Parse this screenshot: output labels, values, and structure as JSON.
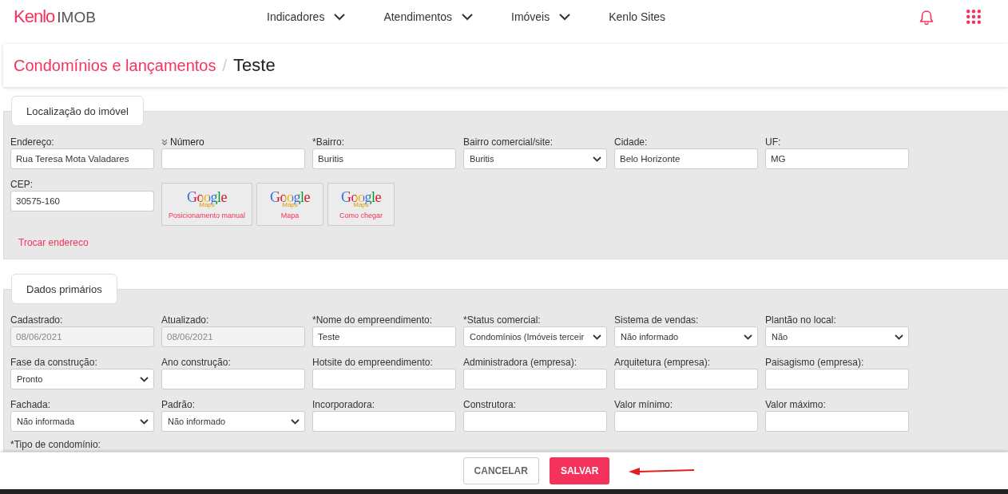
{
  "header": {
    "logo_brand": "Kenlo",
    "logo_product": "IMOB",
    "nav": [
      {
        "label": "Indicadores",
        "dropdown": true
      },
      {
        "label": "Atendimentos",
        "dropdown": true
      },
      {
        "label": "Imóveis",
        "dropdown": true
      },
      {
        "label": "Kenlo Sites",
        "dropdown": false
      }
    ]
  },
  "breadcrumb": {
    "parent": "Condomínios e lançamentos",
    "separator": "/",
    "current": "Teste"
  },
  "sections": [
    {
      "title": "Localização do imóvel",
      "rows": [
        [
          {
            "kind": "text",
            "label": "Endereço:",
            "value": "Rua Teresa Mota Valadares",
            "disabled": false
          },
          {
            "kind": "text",
            "label": "Número",
            "disabled": false,
            "toggle": true
          },
          {
            "kind": "text",
            "label": "*Bairro:",
            "value": "Buritis",
            "disabled": false
          },
          {
            "kind": "select",
            "label": "Bairro comercial/site:",
            "value": "Buritis",
            "disabled": false
          },
          {
            "kind": "text",
            "label": "Cidade:",
            "value": "Belo Horizonte",
            "disabled": false
          },
          {
            "kind": "text",
            "label": "UF:",
            "value": "MG",
            "disabled": false
          }
        ],
        [
          {
            "kind": "text",
            "label": "CEP:",
            "value": "30575-160",
            "disabled": false
          }
        ]
      ],
      "map_buttons": [
        {
          "logo": "Google",
          "logo_sub": "Maps",
          "label": "Posicionamento manual"
        },
        {
          "logo": "Google",
          "logo_sub": "Maps",
          "label": "Mapa"
        },
        {
          "logo": "Google",
          "logo_sub": "Maps",
          "label": "Como chegar"
        }
      ],
      "link": "Trocar endereco"
    },
    {
      "title": "Dados primários",
      "rows": [
        [
          {
            "kind": "text",
            "label": "Cadastrado:",
            "value": "08/06/2021",
            "disabled": true
          },
          {
            "kind": "text",
            "label": "Atualizado:",
            "value": "08/06/2021",
            "disabled": true
          },
          {
            "kind": "text",
            "label": "*Nome do empreendimento:",
            "value": "Teste",
            "disabled": false
          },
          {
            "kind": "select",
            "label": "*Status comercial:",
            "value": "Condomínios (Imóveis terceir",
            "disabled": false
          },
          {
            "kind": "select",
            "label": "Sistema de vendas:",
            "value": "Não informado",
            "disabled": false
          },
          {
            "kind": "select",
            "label": "Plantão no local:",
            "value": "Não",
            "disabled": false
          }
        ],
        [
          {
            "kind": "select",
            "label": "Fase da construção:",
            "value": "Pronto",
            "disabled": false
          },
          {
            "kind": "text",
            "label": "Ano construção:",
            "disabled": false
          },
          {
            "kind": "text",
            "label": "Hotsite do empreendimento:",
            "disabled": false
          },
          {
            "kind": "text",
            "label": "Administradora (empresa):",
            "disabled": false
          },
          {
            "kind": "text",
            "label": "Arquitetura (empresa):",
            "disabled": false
          },
          {
            "kind": "text",
            "label": "Paisagismo (empresa):",
            "disabled": false
          }
        ],
        [
          {
            "kind": "select",
            "label": "Fachada:",
            "value": "Não informada",
            "disabled": false
          },
          {
            "kind": "select",
            "label": "Padrão:",
            "value": "Não informado",
            "disabled": false
          },
          {
            "kind": "text",
            "label": "Incorporadora:",
            "disabled": false
          },
          {
            "kind": "text",
            "label": "Construtora:",
            "disabled": false
          },
          {
            "kind": "text",
            "label": "Valor mínimo:",
            "disabled": false
          },
          {
            "kind": "text",
            "label": "Valor máximo:",
            "disabled": false
          }
        ]
      ],
      "trailing_label": "*Tipo de condomínio:"
    }
  ],
  "footer": {
    "buttons": [
      {
        "label": "CANCELAR",
        "kind": "secondary"
      },
      {
        "label": "SALVAR",
        "kind": "primary"
      }
    ]
  }
}
